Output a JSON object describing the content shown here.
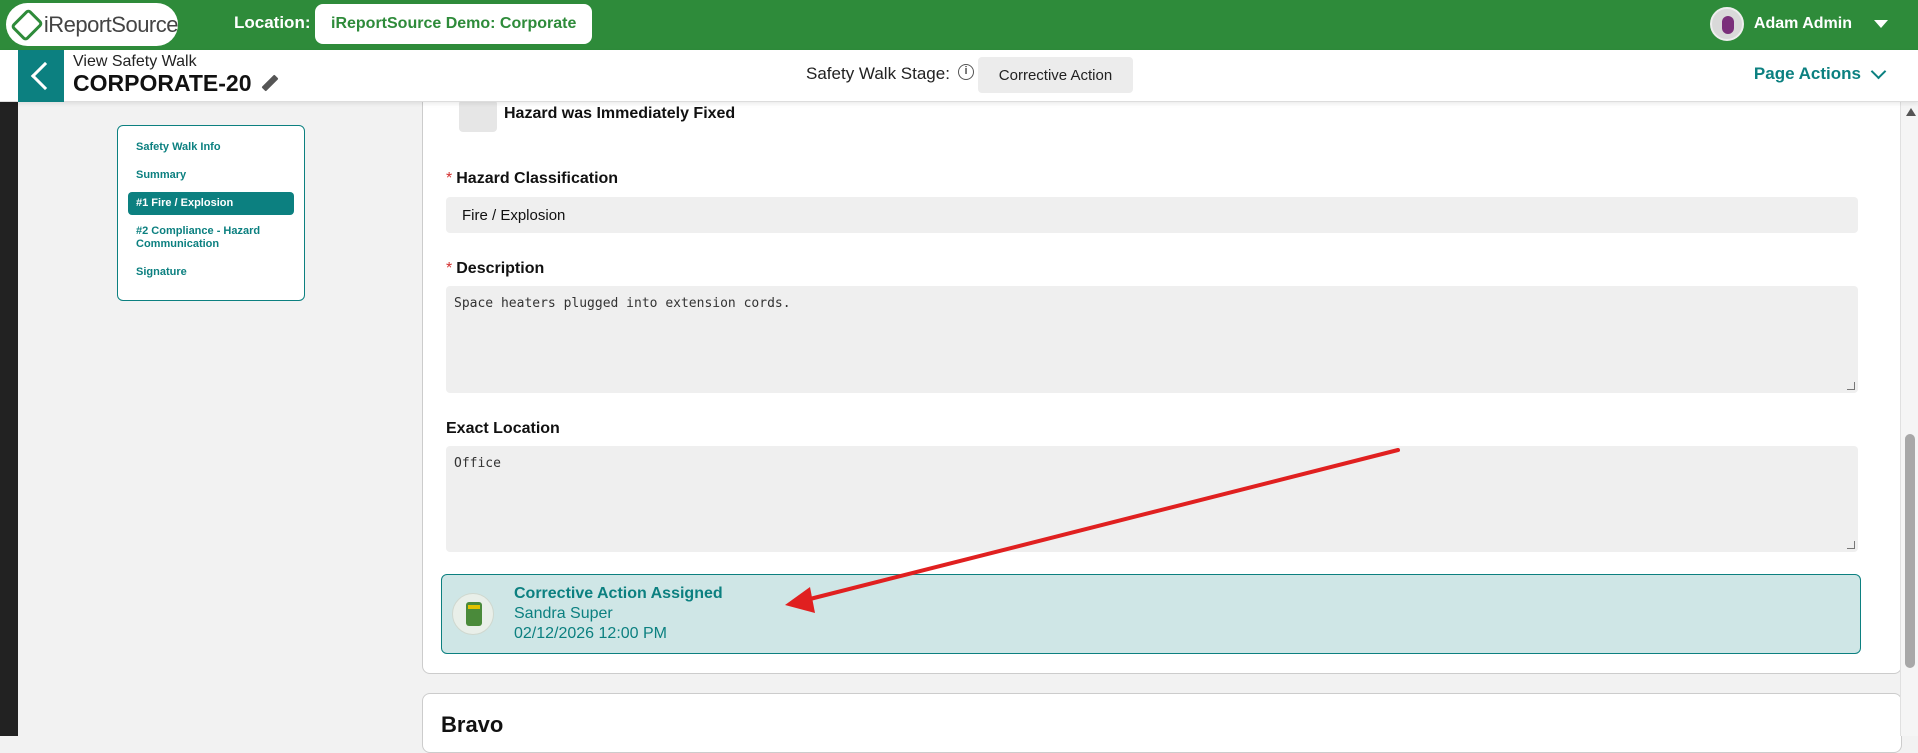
{
  "header": {
    "logo_text": "iReportSource",
    "location_label": "Location:",
    "location_value": "iReportSource Demo: Corporate",
    "user_name": "Adam Admin"
  },
  "subheader": {
    "view_title": "View Safety Walk",
    "record_id": "CORPORATE-20",
    "stage_label": "Safety Walk Stage:",
    "stage_info_glyph": "i",
    "stage_value": "Corrective Action",
    "page_actions": "Page Actions"
  },
  "sidenav": {
    "items": [
      {
        "label": "Safety Walk Info"
      },
      {
        "label": "Summary"
      },
      {
        "label": "#1 Fire / Explosion"
      },
      {
        "label": "#2 Compliance - Hazard Communication"
      },
      {
        "label": "Signature"
      }
    ],
    "active_index": 2
  },
  "form": {
    "hazard_fixed_label": "Hazard was Immediately Fixed",
    "required_marker": "*",
    "classification_label": "Hazard Classification",
    "classification_value": "Fire / Explosion",
    "description_label": "Description",
    "description_value": "Space heaters plugged into extension cords.",
    "exact_location_label": "Exact Location",
    "exact_location_value": "Office"
  },
  "corrective_action": {
    "title": "Corrective Action Assigned",
    "assignee": "Sandra Super",
    "datetime": "02/12/2026 12:00 PM"
  },
  "next_section": {
    "title": "Bravo"
  },
  "colors": {
    "brand_green": "#2e8b3a",
    "teal": "#0c8080",
    "annotation_red": "#e02020"
  }
}
